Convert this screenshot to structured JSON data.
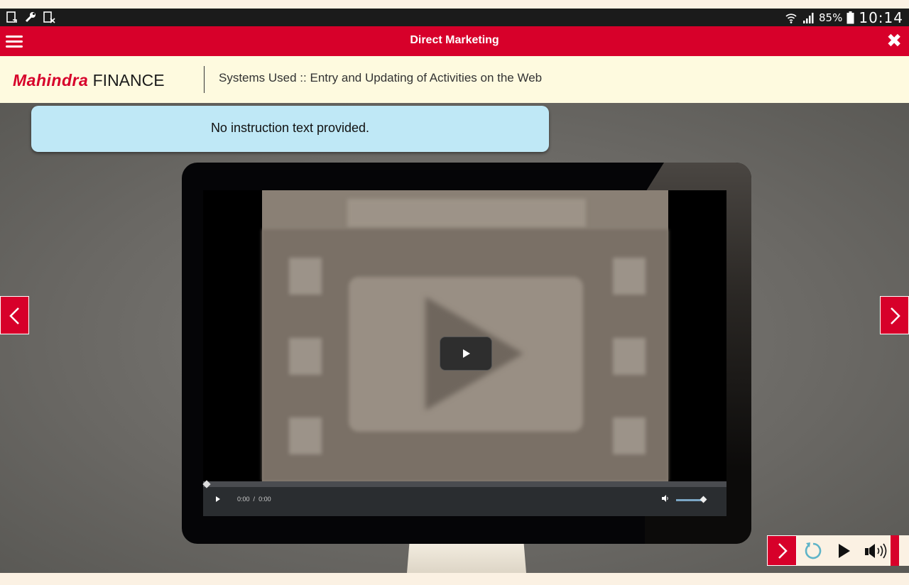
{
  "status_bar": {
    "battery": "85%",
    "time": "10:14"
  },
  "app_bar": {
    "title": "Direct Marketing",
    "menu_icon": "hamburger-menu-icon",
    "close_icon": "close-icon"
  },
  "header": {
    "logo_brand": "Mahindra",
    "logo_suffix": "FINANCE",
    "subtitle": "Systems Used :: Entry and Updating of Activities on the Web"
  },
  "instruction": {
    "text": "No instruction text provided."
  },
  "video_player": {
    "current_time": "0:00",
    "separator": "/",
    "duration": "0:00",
    "progress_fraction": 0,
    "volume_fraction": 1
  },
  "colors": {
    "brand_red": "#d7002a",
    "instruction_bg": "#bfe8f6",
    "header_bg": "#fefadf",
    "replay_teal": "#5fb4c8"
  },
  "bottom_toolbar": {
    "icons": [
      "chevron-right-icon",
      "replay-icon",
      "play-icon",
      "volume-icon"
    ]
  }
}
